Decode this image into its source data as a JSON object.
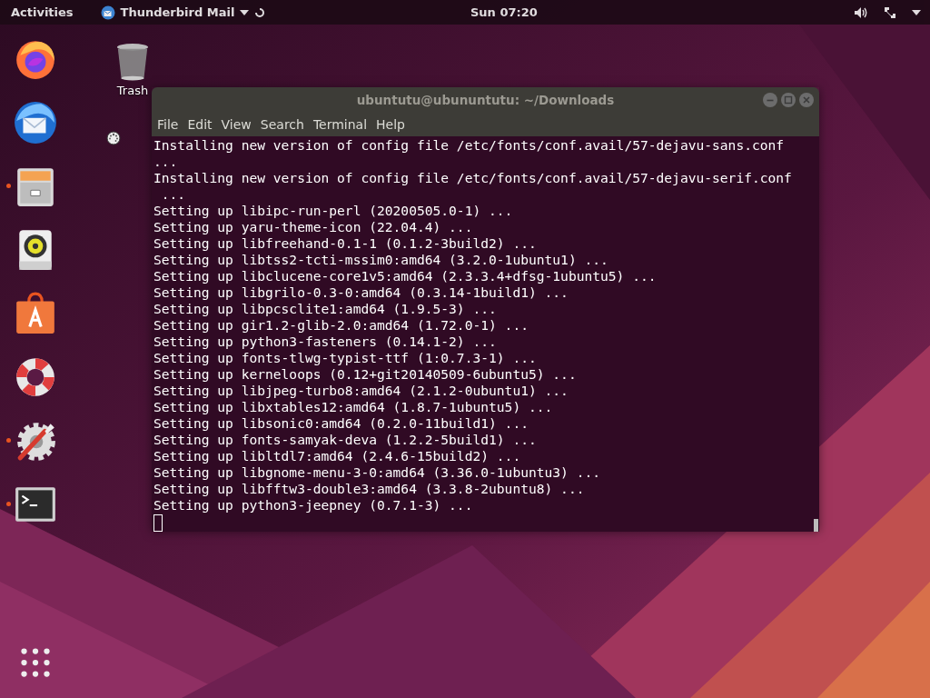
{
  "top_bar": {
    "activities": "Activities",
    "app_name": "Thunderbird Mail",
    "clock": "Sun 07:20"
  },
  "dock": [
    {
      "kind": "firefox",
      "running": false
    },
    {
      "kind": "thunderbird",
      "running": false
    },
    {
      "kind": "files",
      "running": true
    },
    {
      "kind": "rhythmbox",
      "running": false
    },
    {
      "kind": "software",
      "running": false
    },
    {
      "kind": "help",
      "running": false
    },
    {
      "kind": "settings",
      "running": true
    },
    {
      "kind": "terminal",
      "running": true
    },
    {
      "kind": "apps",
      "running": false
    }
  ],
  "desktop_icons": [
    {
      "label": "Trash"
    }
  ],
  "terminal": {
    "title": "ubuntutu@ubununtutu: ~/Downloads",
    "menu": [
      "File",
      "Edit",
      "View",
      "Search",
      "Terminal",
      "Help"
    ],
    "lines": [
      "Installing new version of config file /etc/fonts/conf.avail/57-dejavu-sans.conf",
      "...",
      "Installing new version of config file /etc/fonts/conf.avail/57-dejavu-serif.conf",
      " ...",
      "Setting up libipc-run-perl (20200505.0-1) ...",
      "Setting up yaru-theme-icon (22.04.4) ...",
      "Setting up libfreehand-0.1-1 (0.1.2-3build2) ...",
      "Setting up libtss2-tcti-mssim0:amd64 (3.2.0-1ubuntu1) ...",
      "Setting up libclucene-core1v5:amd64 (2.3.3.4+dfsg-1ubuntu5) ...",
      "Setting up libgrilo-0.3-0:amd64 (0.3.14-1build1) ...",
      "Setting up libpcsclite1:amd64 (1.9.5-3) ...",
      "Setting up gir1.2-glib-2.0:amd64 (1.72.0-1) ...",
      "Setting up python3-fasteners (0.14.1-2) ...",
      "Setting up fonts-tlwg-typist-ttf (1:0.7.3-1) ...",
      "Setting up kerneloops (0.12+git20140509-6ubuntu5) ...",
      "Setting up libjpeg-turbo8:amd64 (2.1.2-0ubuntu1) ...",
      "Setting up libxtables12:amd64 (1.8.7-1ubuntu5) ...",
      "Setting up libsonic0:amd64 (0.2.0-11build1) ...",
      "Setting up fonts-samyak-deva (1.2.2-5build1) ...",
      "Setting up libltdl7:amd64 (2.4.6-15build2) ...",
      "Setting up libgnome-menu-3-0:amd64 (3.36.0-1ubuntu3) ...",
      "Setting up libfftw3-double3:amd64 (3.3.8-2ubuntu8) ...",
      "Setting up python3-jeepney (0.7.1-3) ..."
    ]
  }
}
